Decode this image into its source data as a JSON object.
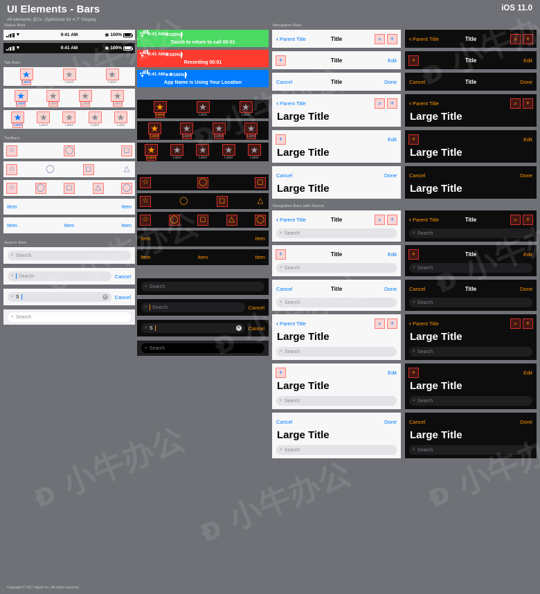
{
  "header": {
    "title": "UI Elements - Bars",
    "subtitle": "All elements @2x. Optimized for 4.7\" Display",
    "version": "iOS 11.0"
  },
  "footer": {
    "copyright": "Copyright © 2017 Apple Inc. All rights reserved."
  },
  "colors": {
    "page_bg": "#6f7176",
    "light_bar": "#f7f7f7",
    "dark_bar": "#0d0d0d",
    "tint_light": "#007aff",
    "tint_dark": "#ff9500",
    "placeholder_outline": "#ff3b30",
    "status_green": "#4cd964",
    "status_red": "#ff3b30",
    "status_blue": "#007aff"
  },
  "sections": {
    "status_bars": "Status Bars",
    "tab_bars": "Tab Bars",
    "toolbars": "Toolbars",
    "search_bars": "Search Bars",
    "navigation_bars": "Navigation Bars",
    "navigation_bars_search": "Navigation Bars with Search"
  },
  "status": {
    "time": "9:41 AM",
    "battery": "100%",
    "bluetooth_icon": "bluetooth-icon",
    "location_icon": "location-arrow-icon",
    "wifi_icon": "wifi-icon",
    "signal_icon": "cellular-signal-icon",
    "banners": [
      {
        "text": "Touch to return to call 00:01",
        "color": "green"
      },
      {
        "text": "Recording 00:01",
        "color": "red"
      },
      {
        "text": "App Name is Using Your Location",
        "color": "blue"
      }
    ]
  },
  "tab_bars": [
    {
      "count": 3,
      "labels": [
        "Label",
        "Label",
        "Label"
      ]
    },
    {
      "count": 4,
      "labels": [
        "Label",
        "Label",
        "Label",
        "Label"
      ]
    },
    {
      "count": 5,
      "labels": [
        "Label",
        "Label",
        "Label",
        "Label",
        "Label"
      ]
    }
  ],
  "toolbars": {
    "icon_rows": [
      [
        "star-icon",
        "circle-icon",
        "square-icon"
      ],
      [
        "star-icon",
        "circle-icon",
        "square-icon",
        "triangle-icon"
      ],
      [
        "star-icon",
        "circle-icon",
        "square-icon",
        "triangle-icon",
        "circle-icon"
      ]
    ],
    "item_rows": [
      [
        "Item",
        "Item"
      ],
      [
        "Item",
        "Item",
        "Item"
      ]
    ]
  },
  "search": {
    "placeholder": "Search",
    "cancel": "Cancel",
    "typed_value": "S",
    "clear_icon": "clear-circle-icon",
    "magnifier_icon": "search-icon"
  },
  "nav": {
    "parent_title": "Parent Title",
    "title": "Title",
    "large_title": "Large Title",
    "edit": "Edit",
    "cancel": "Cancel",
    "done": "Done",
    "search_icon": "search-icon",
    "add_icon": "plus-icon",
    "back_icon": "chevron-left-icon"
  },
  "watermark": "ᴆ 小牛办公"
}
